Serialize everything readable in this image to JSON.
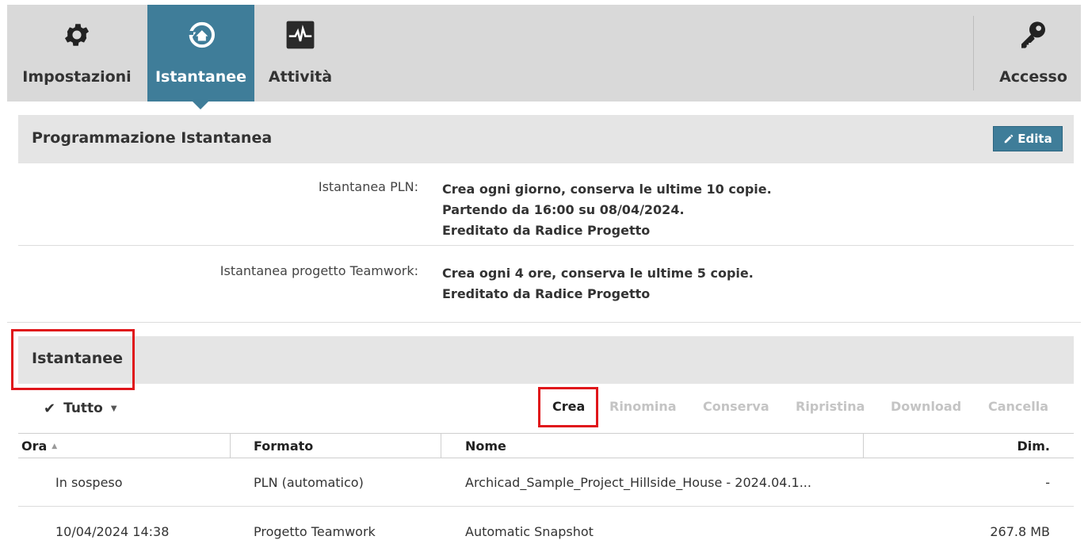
{
  "toolbar": {
    "items": [
      {
        "label": "Impostazioni",
        "icon": "gear-icon"
      },
      {
        "label": "Istantanee",
        "icon": "snapshot-restore-icon"
      },
      {
        "label": "Attività",
        "icon": "activity-pulse-icon"
      }
    ],
    "access": {
      "label": "Accesso",
      "icon": "key-icon"
    },
    "active_color": "#3f7d99"
  },
  "schedule": {
    "title": "Programmazione Istantanea",
    "edit_label": "Edita",
    "rows": [
      {
        "label": "Istantanea PLN:",
        "lines": [
          "Crea ogni giorno, conserva le ultime 10 copie.",
          "Partendo da 16:00 su 08/04/2024.",
          "Ereditato da Radice Progetto"
        ]
      },
      {
        "label": "Istantanea progetto Teamwork:",
        "lines": [
          "Crea ogni 4 ore, conserva le ultime 5 copie.",
          "Ereditato da Radice Progetto"
        ]
      }
    ]
  },
  "snapshots": {
    "title": "Istantanee",
    "select_label": "Tutto",
    "actions": {
      "create": "Crea",
      "rename": "Rinomina",
      "keep": "Conserva",
      "restore": "Ripristina",
      "download": "Download",
      "delete": "Cancella"
    },
    "columns": {
      "time": "Ora",
      "format": "Formato",
      "name": "Nome",
      "size": "Dim."
    },
    "rows": [
      {
        "time": "In sospeso",
        "format": "PLN (automatico)",
        "name": "Archicad_Sample_Project_Hillside_House - 2024.04.1...",
        "size": "-"
      },
      {
        "time": "10/04/2024 14:38",
        "format": "Progetto Teamwork",
        "name": "Automatic Snapshot",
        "size": "267.8 MB"
      }
    ]
  },
  "highlight_color": "#e0161b"
}
